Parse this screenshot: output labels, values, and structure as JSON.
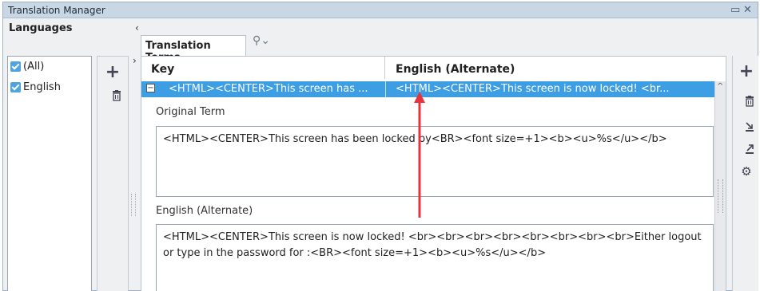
{
  "window": {
    "title": "Translation Manager",
    "controls": [
      "restore-icon",
      "close-icon"
    ]
  },
  "languages": {
    "header": "Languages",
    "items": [
      {
        "label": "(All)",
        "checked": true
      },
      {
        "label": "English",
        "checked": true
      }
    ],
    "tools": [
      "add-icon",
      "delete-icon"
    ]
  },
  "terms": {
    "tab_label": "Translation Terms",
    "search_icon": "search-icon",
    "columns": [
      "Key",
      "English (Alternate)"
    ],
    "selected_row": {
      "key": "<HTML><CENTER>This screen has ...",
      "alternate": "<HTML><CENTER>This screen is now locked! <br..."
    },
    "original_term_label": "Original Term",
    "original_term_value": "<HTML><CENTER>This screen has been locked by<BR><font size=+1><b><u>%s</u></b>",
    "alternate_label": "English (Alternate)",
    "alternate_value": "<HTML><CENTER>This screen is now locked! <br><br><br><br><br><br><br><br>Either logout or type in the password for :<BR><font size=+1><b><u>%s</u></b>"
  },
  "right_tools": [
    "add-icon",
    "delete-icon",
    "import-icon",
    "export-icon",
    "settings-icon"
  ],
  "colors": {
    "selection": "#3d9ee3",
    "titlebar": "#c9d6e3",
    "annotation_arrow": "#e8323c"
  }
}
